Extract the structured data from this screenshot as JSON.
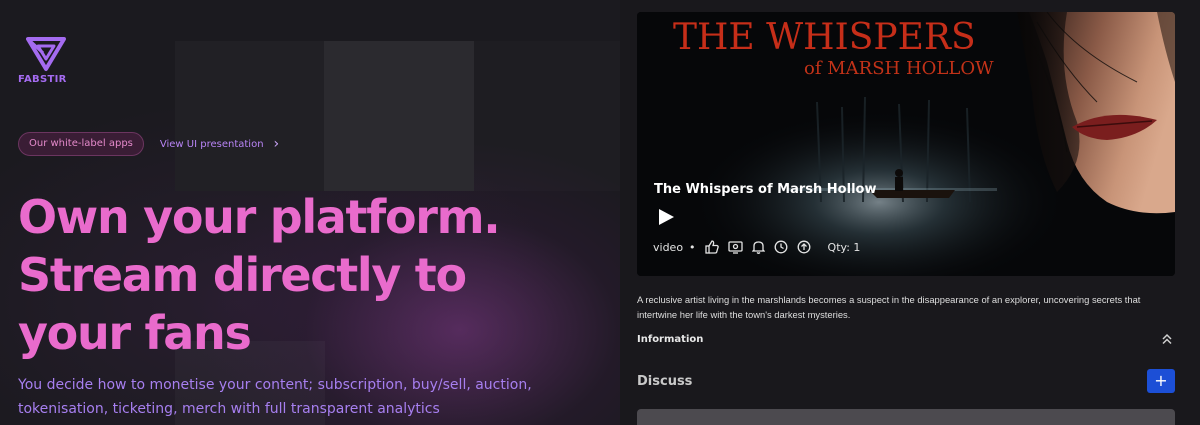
{
  "brand": {
    "name": "FABSTIR",
    "accent": "#a46bf0"
  },
  "hero": {
    "pill_label": "Our white-label apps",
    "link_label": "View UI presentation",
    "link_icon": "chevron-right-icon",
    "headline": [
      "Own your platform.",
      "Stream directly to",
      "your fans"
    ],
    "subtext": [
      "You decide how to monetise your content; subscription, buy/sell, auction,",
      "tokenisation, ticketing, merch with full transparent analytics"
    ],
    "colors": {
      "headline": "#e96bcc",
      "subtext": "#a77ff0",
      "pill_bg": "#3a1d35"
    }
  },
  "media": {
    "poster_title": "THE WHISPERS",
    "poster_subtitle": "of MARSH HOLLOW",
    "title": "The Whispers of Marsh Hollow",
    "type": "video",
    "separator": "•",
    "quantity_label": "Qty: 1",
    "action_icons": [
      "thumbs-up-icon",
      "screen-icon",
      "bell-icon",
      "clock-icon",
      "upload-icon"
    ],
    "description": [
      "A reclusive artist living in the marshlands becomes a suspect in the disappearance of an explorer, uncovering secrets that",
      "intertwine her life with the town's darkest mysteries."
    ]
  },
  "information": {
    "label": "Information",
    "icon": "chevrons-up-icon"
  },
  "discuss": {
    "label": "Discuss",
    "add_label": "+",
    "button_color": "#1c4fd6"
  }
}
